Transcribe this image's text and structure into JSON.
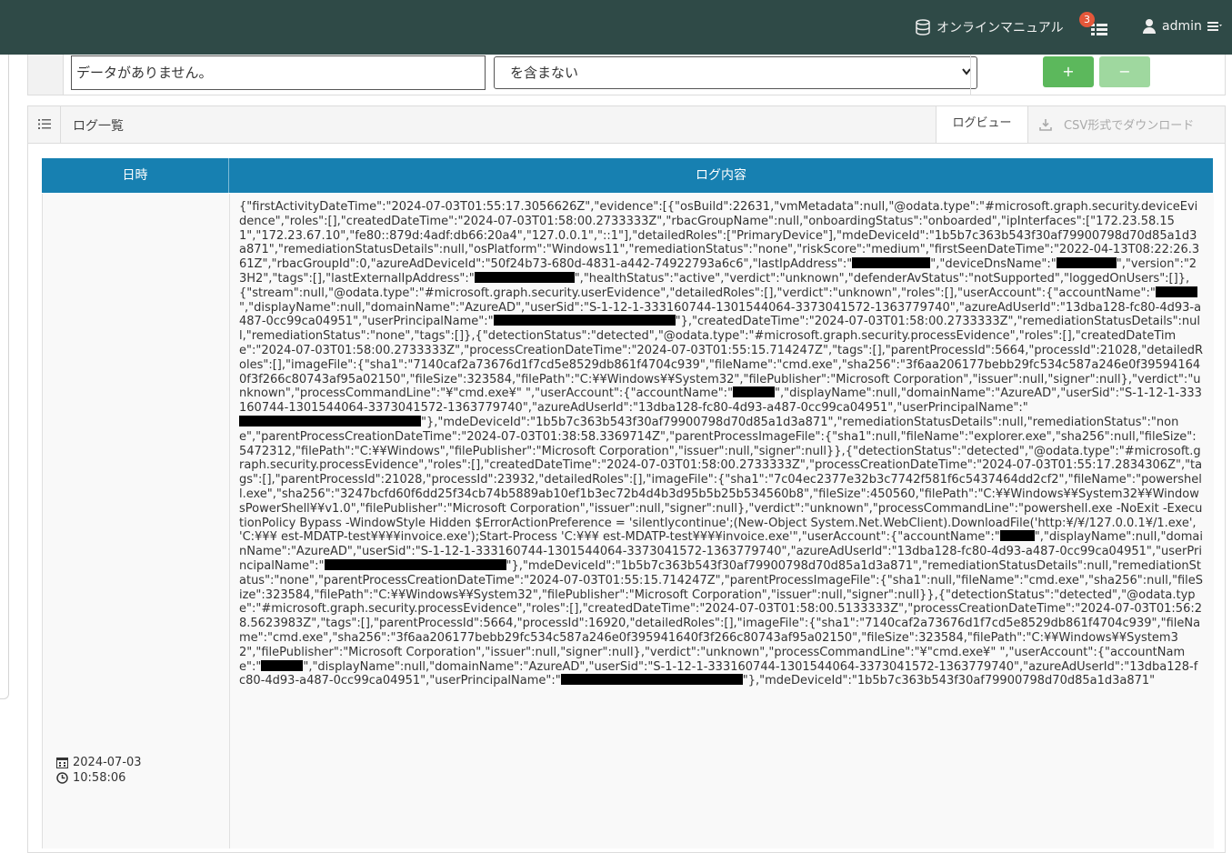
{
  "nav": {
    "manual_label": "オンラインマニュアル",
    "task_badge": "3",
    "user_label": "admin"
  },
  "filter": {
    "text_value": "データがありません。",
    "condition_value": "を含まない",
    "add_label": "+",
    "remove_label": "−"
  },
  "panel": {
    "title": "ログ一覧",
    "tab_logview": "ログビュー",
    "tab_csv": "CSV形式でダウンロード"
  },
  "table": {
    "col_date": "日時",
    "col_log": "ログ内容"
  },
  "row": {
    "date": "2024-07-03",
    "time": "10:58:06",
    "log_parts": [
      "{\"firstActivityDateTime\":\"2024-07-03T01:55:17.3056626Z\",\"evidence\":[{\"osBuild\":22631,\"vmMetadata\":null,\"@odata.type\":\"#microsoft.graph.security.deviceEvidence\",\"roles\":[],\"createdDateTime\":\"2024-07-03T01:58:00.2733333Z\",\"rbacGroupName\":null,\"onboardingStatus\":\"onboarded\",\"ipInterfaces\":[\"172.23.58.151\",\"172.23.67.10\",\"fe80::879d:4adf:db66:20a4\",\"127.0.0.1\",\"::1\"],\"detailedRoles\":[\"PrimaryDevice\"],\"mdeDeviceId\":\"1b5b7c363b543f30af79900798d70d85a1d3a871\",\"remediationStatusDetails\":null,\"osPlatform\":\"Windows11\",\"remediationStatus\":\"none\",\"riskScore\":\"medium\",\"firstSeenDateTime\":\"2022-04-13T08:22:26.361Z\",\"rbacGroupId\":0,\"azureAdDeviceId\":\"50f24b73-680d-4831-a442-74922793a6c6\",\"lastIpAddress\":\"",
      "\",\"deviceDnsName\":\"",
      "\",\"version\":\"23H2\",\"tags\":[],\"lastExternalIpAddress\":\"",
      "\",\"healthStatus\":\"active\",\"verdict\":\"unknown\",\"defenderAvStatus\":\"notSupported\",\"loggedOnUsers\":[]},{\"stream\":null,\"@odata.type\":\"#microsoft.graph.security.userEvidence\",\"detailedRoles\":[],\"verdict\":\"unknown\",\"roles\":[],\"userAccount\":{\"accountName\":\"",
      "\",\"displayName\":null,\"domainName\":\"AzureAD\",\"userSid\":\"S-1-12-1-333160744-1301544064-3373041572-1363779740\",\"azureAdUserId\":\"13dba128-fc80-4d93-a487-0cc99ca04951\",\"userPrincipalName\":\"",
      "\"},\"createdDateTime\":\"2024-07-03T01:58:00.2733333Z\",\"remediationStatusDetails\":null,\"remediationStatus\":\"none\",\"tags\":[]},{\"detectionStatus\":\"detected\",\"@odata.type\":\"#microsoft.graph.security.processEvidence\",\"roles\":[],\"createdDateTime\":\"2024-07-03T01:58:00.2733333Z\",\"processCreationDateTime\":\"2024-07-03T01:55:15.714247Z\",\"tags\":[],\"parentProcessId\":5664,\"processId\":21028,\"detailedRoles\":[],\"imageFile\":{\"sha1\":\"7140caf2a73676d1f7cd5e8529db861f4704c939\",\"fileName\":\"cmd.exe\",\"sha256\":\"3f6aa206177bebb29fc534c587a246e0f395941640f3f266c80743af95a02150\",\"fileSize\":323584,\"filePath\":\"C:¥¥Windows¥¥System32\",\"filePublisher\":\"Microsoft Corporation\",\"issuer\":null,\"signer\":null},\"verdict\":\"unknown\",\"processCommandLine\":\"¥\"cmd.exe¥\" \",\"userAccount\":{\"accountName\":\"",
      "\",\"displayName\":null,\"domainName\":\"AzureAD\",\"userSid\":\"S-1-12-1-333160744-1301544064-3373041572-1363779740\",\"azureAdUserId\":\"13dba128-fc80-4d93-a487-0cc99ca04951\",\"userPrincipalName\":\"",
      "\"},\"mdeDeviceId\":\"1b5b7c363b543f30af79900798d70d85a1d3a871\",\"remediationStatusDetails\":null,\"remediationStatus\":\"none\",\"parentProcessCreationDateTime\":\"2024-07-03T01:38:58.3369714Z\",\"parentProcessImageFile\":{\"sha1\":null,\"fileName\":\"explorer.exe\",\"sha256\":null,\"fileSize\":5472312,\"filePath\":\"C:¥¥Windows\",\"filePublisher\":\"Microsoft Corporation\",\"issuer\":null,\"signer\":null}},{\"detectionStatus\":\"detected\",\"@odata.type\":\"#microsoft.graph.security.processEvidence\",\"roles\":[],\"createdDateTime\":\"2024-07-03T01:58:00.2733333Z\",\"processCreationDateTime\":\"2024-07-03T01:55:17.2834306Z\",\"tags\":[],\"parentProcessId\":21028,\"processId\":23932,\"detailedRoles\":[],\"imageFile\":{\"sha1\":\"7c04ec2377e32b3c7742f581f6c5437464dd2cf2\",\"fileName\":\"powershell.exe\",\"sha256\":\"3247bcfd60f6dd25f34cb74b5889ab10ef1b3ec72b4d4b3d95b5b25b534560b8\",\"fileSize\":450560,\"filePath\":\"C:¥¥Windows¥¥System32¥¥WindowsPowerShell¥¥v1.0\",\"filePublisher\":\"Microsoft Corporation\",\"issuer\":null,\"signer\":null},\"verdict\":\"unknown\",\"processCommandLine\":\"powershell.exe -NoExit -ExecutionPolicy Bypass -WindowStyle Hidden $ErrorActionPreference = 'silentlycontinue';(New-Object System.Net.WebClient).DownloadFile('http:¥/¥/127.0.0.1¥/1.exe', 'C:¥¥¥    est-MDATP-test¥¥¥¥invoice.exe');Start-Process 'C:¥¥¥    est-MDATP-test¥¥¥¥invoice.exe'\",\"userAccount\":{\"accountName\":\"",
      "\",\"displayName\":null,\"domainName\":\"AzureAD\",\"userSid\":\"S-1-12-1-333160744-1301544064-3373041572-1363779740\",\"azureAdUserId\":\"13dba128-fc80-4d93-a487-0cc99ca04951\",\"userPrincipalName\":\"",
      "\"},\"mdeDeviceId\":\"1b5b7c363b543f30af79900798d70d85a1d3a871\",\"remediationStatusDetails\":null,\"remediationStatus\":\"none\",\"parentProcessCreationDateTime\":\"2024-07-03T01:55:15.714247Z\",\"parentProcessImageFile\":{\"sha1\":null,\"fileName\":\"cmd.exe\",\"sha256\":null,\"fileSize\":323584,\"filePath\":\"C:¥¥Windows¥¥System32\",\"filePublisher\":\"Microsoft Corporation\",\"issuer\":null,\"signer\":null}},{\"detectionStatus\":\"detected\",\"@odata.type\":\"#microsoft.graph.security.processEvidence\",\"roles\":[],\"createdDateTime\":\"2024-07-03T01:58:00.5133333Z\",\"processCreationDateTime\":\"2024-07-03T01:56:28.5623983Z\",\"tags\":[],\"parentProcessId\":5664,\"processId\":16920,\"detailedRoles\":[],\"imageFile\":{\"sha1\":\"7140caf2a73676d1f7cd5e8529db861f4704c939\",\"fileName\":\"cmd.exe\",\"sha256\":\"3f6aa206177bebb29fc534c587a246e0f395941640f3f266c80743af95a02150\",\"fileSize\":323584,\"filePath\":\"C:¥¥Windows¥¥System32\",\"filePublisher\":\"Microsoft Corporation\",\"issuer\":null,\"signer\":null},\"verdict\":\"unknown\",\"processCommandLine\":\"¥\"cmd.exe¥\" \",\"userAccount\":{\"accountName\":\"",
      "\",\"displayName\":null,\"domainName\":\"AzureAD\",\"userSid\":\"S-1-12-1-333160744-1301544064-3373041572-1363779740\",\"azureAdUserId\":\"13dba128-fc80-4d93-a487-0cc99ca04951\",\"userPrincipalName\":\"",
      "\"},\"mdeDeviceId\":\"1b5b7c363b543f30af79900798d70d85a1d3a871\""
    ]
  }
}
